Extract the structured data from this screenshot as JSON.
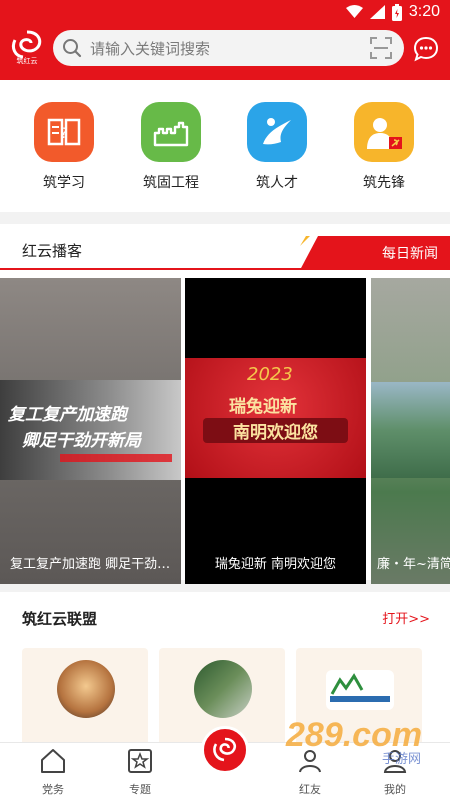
{
  "status_bar": {
    "time": "3:20"
  },
  "header": {
    "logo_text": "筑红云",
    "search_placeholder": "请输入关键词搜索",
    "accent": "#e4141b"
  },
  "quick_nav": [
    {
      "label": "筑学习",
      "icon": "book-icon",
      "color": "#f25a2b"
    },
    {
      "label": "筑固工程",
      "icon": "great-wall-icon",
      "color": "#67ba48"
    },
    {
      "label": "筑人才",
      "icon": "talent-icon",
      "color": "#2ba4e8"
    },
    {
      "label": "筑先锋",
      "icon": "pioneer-icon",
      "color": "#f7b52b"
    }
  ],
  "podcast": {
    "title": "红云播客",
    "tab_label": "每日新闻",
    "cards": [
      {
        "caption": "复工复产加速跑 卿足干劲…",
        "banner_line1": "复工复产加速跑",
        "banner_line2": "卿足干劲开新局"
      },
      {
        "caption": "瑞兔迎新 南明欢迎您",
        "banner_line1": "瑞兔迎新",
        "banner_line2": "南明欢迎您"
      },
      {
        "caption": "廉・年~清简"
      }
    ]
  },
  "alliance": {
    "title": "筑红云联盟",
    "open_label": "打开>>"
  },
  "tabbar": {
    "items": [
      {
        "label": "党务",
        "icon": "home-icon"
      },
      {
        "label": "专题",
        "icon": "star-icon"
      },
      {
        "label": "",
        "icon": "center-logo-icon"
      },
      {
        "label": "红友",
        "icon": "friends-icon"
      },
      {
        "label": "我的",
        "icon": "profile-icon"
      }
    ]
  },
  "watermark": {
    "text": "289.com",
    "subtext": "手游网"
  }
}
